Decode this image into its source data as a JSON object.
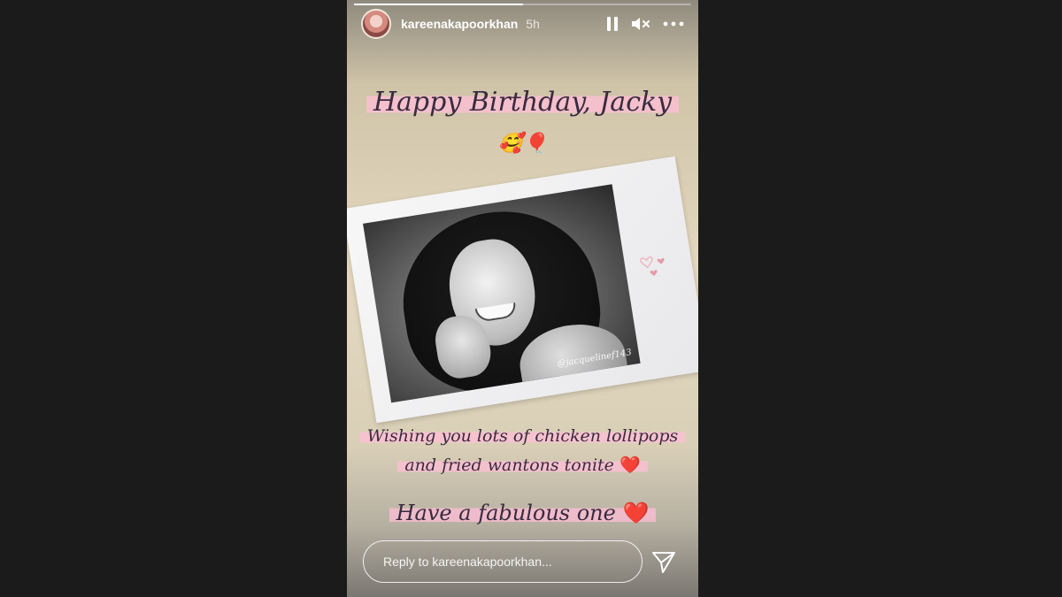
{
  "story": {
    "progress": 0.5,
    "username": "kareenakapoorkhan",
    "time": "5h",
    "header_icons": [
      "pause-icon",
      "mute-icon",
      "more-icon"
    ]
  },
  "content": {
    "title": "Happy Birthday, Jacky",
    "emoji": "🥰🎈",
    "photo_watermark": "@jacquelinef143",
    "wish_line1": "Wishing you lots of chicken lollipops",
    "wish_line2": "and fried wantons tonite",
    "wish_line3": "Have a fabulous one",
    "heart": "❤️"
  },
  "reply": {
    "placeholder": "Reply to kareenakapoorkhan..."
  },
  "colors": {
    "page_bg": "#1b1b1b",
    "highlight": "#ffbed6",
    "heart": "#d8252d"
  }
}
